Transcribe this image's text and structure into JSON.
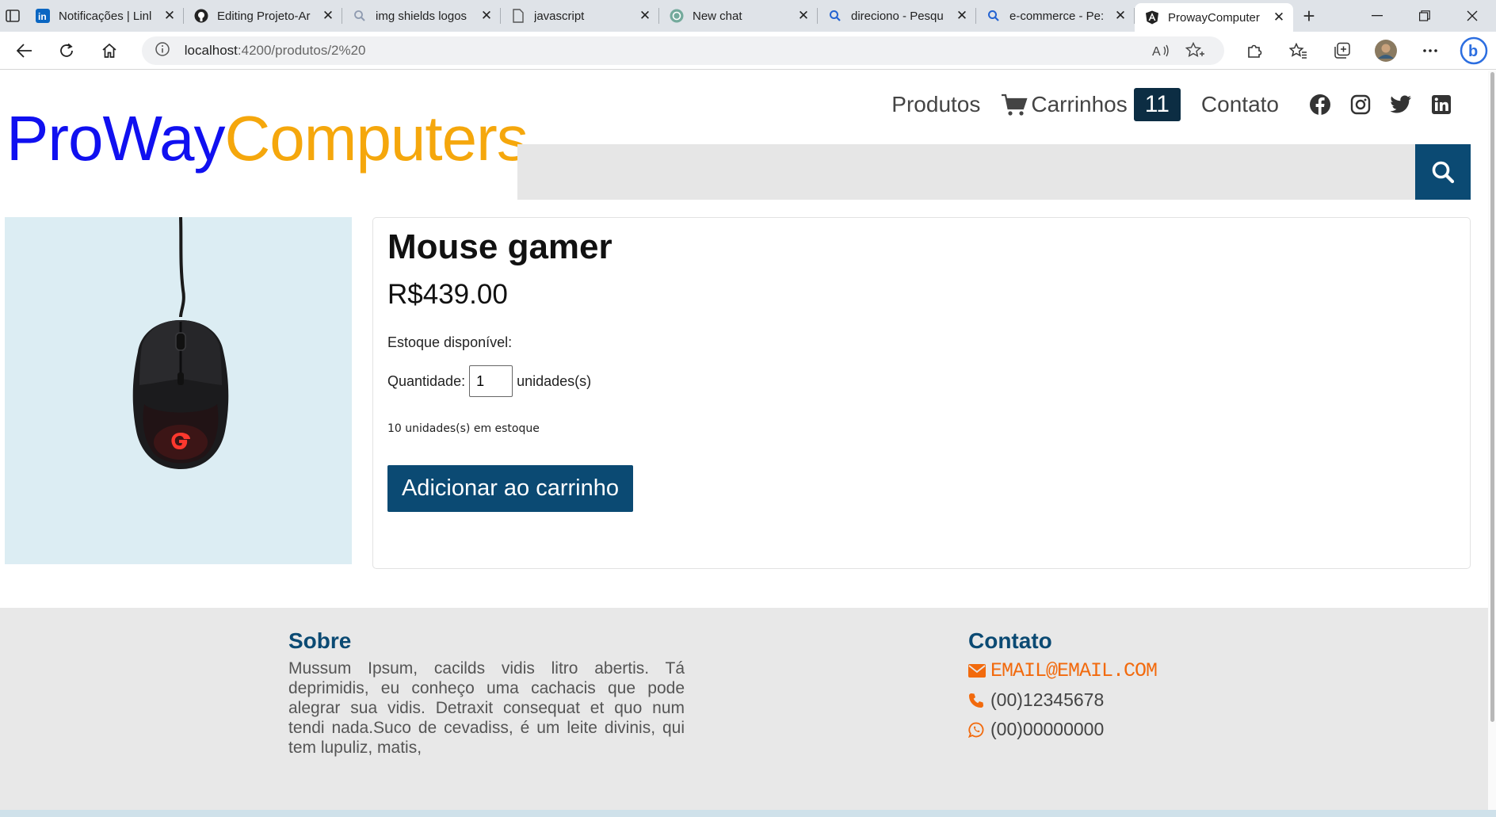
{
  "browser": {
    "tabs": [
      {
        "title": "Notificações | Linl",
        "icon": "linkedin-icon"
      },
      {
        "title": "Editing Projeto-Ar",
        "icon": "github-icon"
      },
      {
        "title": "img shields logos",
        "icon": "search-icon"
      },
      {
        "title": "javascript",
        "icon": "page-icon"
      },
      {
        "title": "New chat",
        "icon": "chatgpt-icon"
      },
      {
        "title": "direciono - Pesqu",
        "icon": "search-icon"
      },
      {
        "title": "e-commerce - Pe:",
        "icon": "search-icon"
      },
      {
        "title": "ProwayComputer",
        "icon": "angular-icon",
        "active": true
      }
    ],
    "url_host": "localhost",
    "url_path": ":4200/produtos/2%20"
  },
  "header": {
    "logo_part1": "ProWay",
    "logo_part2": "Computers",
    "nav_produtos": "Produtos",
    "nav_carrinhos": "Carrinhos",
    "cart_count": "11",
    "nav_contato": "Contato",
    "search_placeholder": ""
  },
  "product": {
    "name": "Mouse gamer",
    "price": "R$439.00",
    "stock_label": "Estoque disponível:",
    "qty_label": "Quantidade:",
    "qty_value": "1",
    "qty_unit": "unidades(s)",
    "in_stock": "10 unidades(s) em estoque",
    "add_button": "Adicionar ao carrinho"
  },
  "footer": {
    "about_title": "Sobre",
    "about_text": "Mussum Ipsum, cacilds vidis litro abertis. Tá deprimidis, eu conheço uma cachacis que pode alegrar sua vidis. Detraxit consequat et quo num tendi nada.Suco de cevadiss, é um leite divinis, qui tem lupuliz, matis,",
    "contact_title": "Contato",
    "email": "EMAIL@EMAIL.COM",
    "phone": "(00)12345678",
    "whatsapp": "(00)00000000"
  },
  "colors": {
    "logo_blue": "#1010f0",
    "logo_orange": "#f5a70c",
    "primary": "#0b4a73",
    "badge": "#0c2d43",
    "accent_orange": "#f26a0d"
  }
}
